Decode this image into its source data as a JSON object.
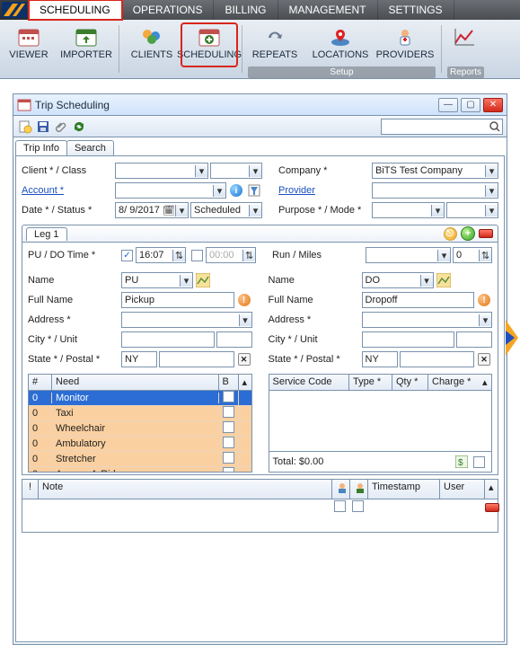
{
  "menu": {
    "items": [
      "SCHEDULING",
      "OPERATIONS",
      "BILLING",
      "MANAGEMENT",
      "SETTINGS"
    ],
    "selected": 0
  },
  "ribbon": {
    "groups": [
      {
        "label": "",
        "items": [
          {
            "name": "viewer",
            "label": "VIEWER",
            "icon": "calendar-icon"
          },
          {
            "name": "importer",
            "label": "IMPORTER",
            "icon": "import-icon"
          }
        ]
      },
      {
        "label": "",
        "items": [
          {
            "name": "clients",
            "label": "CLIENTS",
            "icon": "people-icon"
          },
          {
            "name": "scheduling",
            "label": "SCHEDULING",
            "icon": "calendar-plus-icon",
            "highlight": true
          }
        ]
      },
      {
        "label": "Setup",
        "items": [
          {
            "name": "repeats",
            "label": "REPEATS",
            "icon": "repeat-icon"
          },
          {
            "name": "locations",
            "label": "LOCATIONS",
            "icon": "location-icon"
          },
          {
            "name": "providers",
            "label": "PROVIDERS",
            "icon": "provider-icon"
          }
        ]
      },
      {
        "label": "Reports",
        "items": [
          {
            "name": "reports",
            "label": "",
            "icon": "chart-icon"
          }
        ]
      }
    ]
  },
  "window": {
    "title": "Trip Scheduling",
    "tabs": [
      "Trip Info",
      "Search"
    ],
    "selected_tab": 0,
    "search_placeholder": ""
  },
  "form": {
    "left": {
      "client_label": "Client *",
      "class_label": " / Class",
      "account_label": "Account *",
      "date_label": "Date *",
      "status_label": " / Status *",
      "date_value": "8/ 9/2017",
      "status_value": "Scheduled"
    },
    "right": {
      "company_label": "Company *",
      "company_value": "BiTS Test Company",
      "provider_label": "Provider",
      "purpose_label": "Purpose *",
      "mode_label": " / Mode *"
    }
  },
  "leg": {
    "tab": "Leg 1",
    "pu_do_label": "PU / DO Time *",
    "pu_checked": true,
    "pu_time": "16:07",
    "do_checked": false,
    "do_time": "00:00",
    "run_label": "Run / Miles",
    "miles": "0",
    "pickup": {
      "name_label": "Name",
      "name_value": "PU",
      "fullname_label": "Full Name",
      "fullname_value": "Pickup",
      "address_label": "Address *",
      "city_label": "City *",
      "unit_label": " / Unit",
      "state_label": "State *",
      "postal_label": " / Postal *",
      "state_value": "NY"
    },
    "dropoff": {
      "name_label": "Name",
      "name_value": "DO",
      "fullname_label": "Full Name",
      "fullname_value": "Dropoff",
      "address_label": "Address *",
      "city_label": "City *",
      "unit_label": " / Unit",
      "state_label": "State *",
      "postal_label": " / Postal *",
      "state_value": "NY"
    }
  },
  "needs": {
    "headers": [
      "#",
      "Need",
      "B"
    ],
    "rows": [
      {
        "n": "0",
        "need": "Monitor",
        "sel": true
      },
      {
        "n": "0",
        "need": "Taxi"
      },
      {
        "n": "0",
        "need": "Wheelchair"
      },
      {
        "n": "0",
        "need": "Ambulatory"
      },
      {
        "n": "0",
        "need": "Stretcher"
      },
      {
        "n": "0",
        "need": "Access-A-Ride"
      }
    ]
  },
  "services": {
    "headers": [
      "Service Code",
      "Type *",
      "Qty *",
      "Charge *"
    ],
    "total_label": "Total: $0.00"
  },
  "notes": {
    "headers": [
      "!",
      "Note",
      "",
      "",
      "Timestamp",
      "User"
    ]
  }
}
